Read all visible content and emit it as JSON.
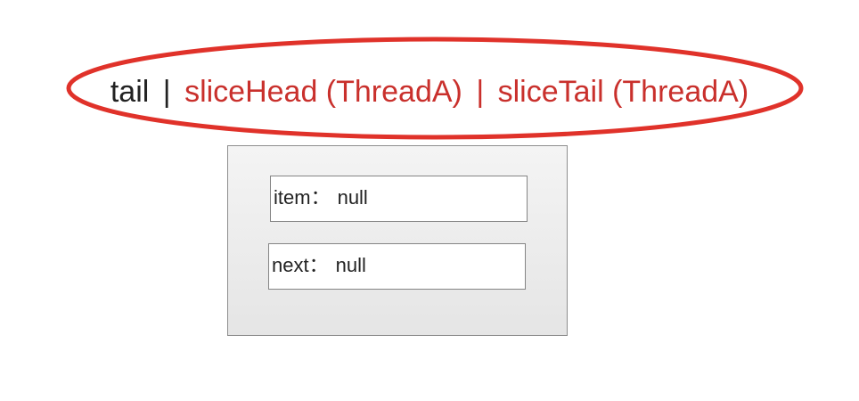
{
  "pointers": {
    "tail": "tail",
    "sep": "|",
    "slice_head": "sliceHead (ThreadA)",
    "slice_tail": "sliceTail (ThreadA)"
  },
  "node": {
    "item_key": "item",
    "item_value": "null",
    "next_key": "next",
    "next_value": "null",
    "colon": "："
  },
  "colors": {
    "tail_text": "#222222",
    "slice_text": "#c9302c",
    "highlight_ellipse": "#e0322a",
    "node_border": "#8e8e8e"
  }
}
